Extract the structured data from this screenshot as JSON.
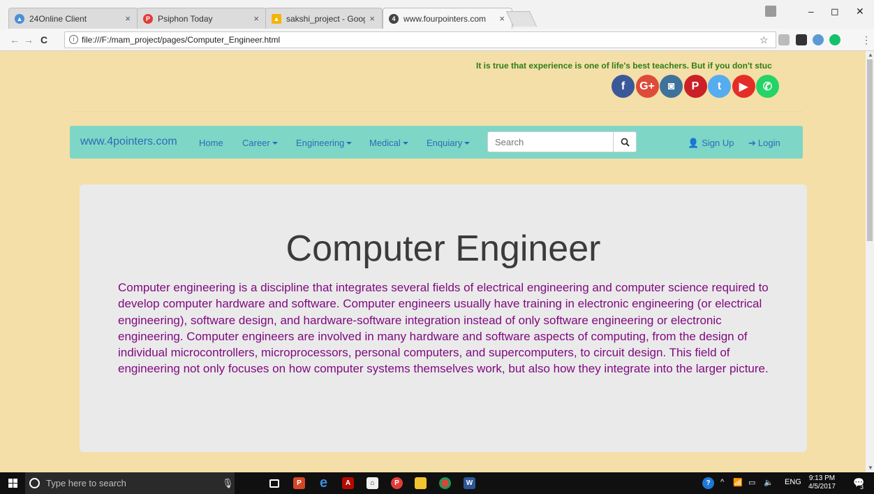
{
  "browser": {
    "tabs": [
      {
        "label": "24Online Client",
        "active": false
      },
      {
        "label": "Psiphon Today",
        "active": false
      },
      {
        "label": "sakshi_project - Google D",
        "active": false
      },
      {
        "label": "www.fourpointers.com",
        "active": true
      }
    ],
    "url": "file:///F:/mam_project/pages/Computer_Engineer.html",
    "window_controls": {
      "minimize": "–",
      "restore": "◻",
      "close": "✕"
    }
  },
  "page": {
    "quote": "It is true that experience is one of life's best teachers. But if you don't stuc",
    "social_icons": [
      {
        "name": "facebook-icon",
        "glyph": "f",
        "color": "#3b5998"
      },
      {
        "name": "google-plus-icon",
        "glyph": "G+",
        "color": "#dd4b39"
      },
      {
        "name": "instagram-icon",
        "glyph": "◙",
        "color": "#3f729b"
      },
      {
        "name": "pinterest-icon",
        "glyph": "P",
        "color": "#cb2027"
      },
      {
        "name": "twitter-icon",
        "glyph": "t",
        "color": "#55acee"
      },
      {
        "name": "youtube-icon",
        "glyph": "▶",
        "color": "#e52d27"
      },
      {
        "name": "whatsapp-icon",
        "glyph": "✆",
        "color": "#25d366"
      }
    ],
    "navbar": {
      "brand": "www.4pointers.com",
      "home": "Home",
      "career": "Career",
      "engineering": "Engineering",
      "medical": "Medical",
      "enquiry": "Enquiary",
      "search_placeholder": "Search",
      "signup": "Sign Up",
      "login": "Login"
    },
    "jumbotron": {
      "title": "Computer Engineer",
      "text": "Computer engineering is a discipline that integrates several fields of electrical engineering and computer science required to develop computer hardware and software. Computer engineers usually have training in electronic engineering (or electrical engineering), software design, and hardware-software integration instead of only software engineering or electronic engineering. Computer engineers are involved in many hardware and software aspects of computing, from the design of individual microcontrollers, microprocessors, personal computers, and supercomputers, to circuit design. This field of engineering not only focuses on how computer systems themselves work, but also how they integrate into the larger picture."
    }
  },
  "taskbar": {
    "search_placeholder": "Type here to search",
    "language": "ENG",
    "time": "9:13 PM",
    "date": "4/5/2017",
    "notifications": "3"
  }
}
